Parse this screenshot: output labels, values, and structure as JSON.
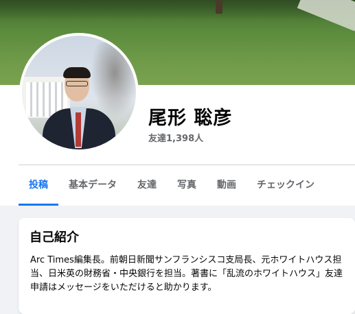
{
  "profile": {
    "name": "尾形 聡彦",
    "friends": "友達1,398人"
  },
  "tabs": [
    {
      "label": "投稿",
      "active": true
    },
    {
      "label": "基本データ",
      "active": false
    },
    {
      "label": "友達",
      "active": false
    },
    {
      "label": "写真",
      "active": false
    },
    {
      "label": "動画",
      "active": false
    },
    {
      "label": "チェックイン",
      "active": false
    }
  ],
  "intro": {
    "title": "自己紹介",
    "text": "Arc Times編集長。前朝日新聞サンフランシスコ支局長、元ホワイトハウス担当、日米英の財務省・中央銀行を担当。著書に「乱流のホワイトハウス」友達申請はメッセージをいただけると助かります。"
  },
  "colors": {
    "accent": "#1877f2",
    "page_bg": "#f0f2f5",
    "muted_text": "#65676b"
  }
}
